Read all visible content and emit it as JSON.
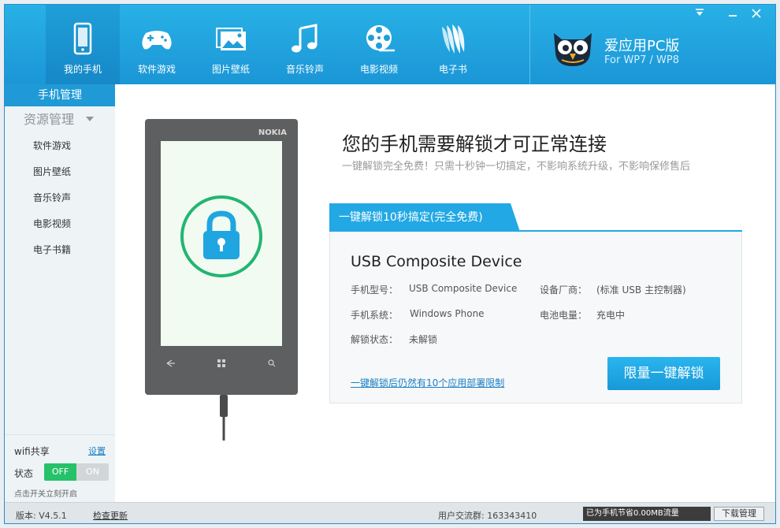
{
  "nav": {
    "items": [
      {
        "label": "我的手机",
        "icon": "phone-icon"
      },
      {
        "label": "软件游戏",
        "icon": "gamepad-icon"
      },
      {
        "label": "图片壁纸",
        "icon": "picture-icon"
      },
      {
        "label": "音乐铃声",
        "icon": "music-note-icon"
      },
      {
        "label": "电影视频",
        "icon": "film-reel-icon"
      },
      {
        "label": "电子书",
        "icon": "ebook-icon"
      }
    ]
  },
  "brand": {
    "name": "爱应用PC版",
    "subtitle": "For WP7 / WP8"
  },
  "sidebar": {
    "header": "手机管理",
    "group": "资源管理",
    "items": [
      "软件游戏",
      "图片壁纸",
      "音乐铃声",
      "电影视频",
      "电子书籍"
    ],
    "wifi": {
      "title": "wifi共享",
      "setup": "设置",
      "state_label": "状态",
      "off_label": "OFF",
      "on_label": "ON",
      "hint": "点击开关立刻开启"
    }
  },
  "main": {
    "phone_brand": "NOKIA",
    "headline": "您的手机需要解锁才可正常连接",
    "subline": "一键解锁完全免费！只需十秒钟一切搞定，不影响系统升级，不影响保修售后",
    "tab": "一键解锁10秒搞定(完全免费)",
    "device": {
      "name": "USB Composite Device",
      "model_label": "手机型号：",
      "model": "USB Composite Device",
      "vendor_label": "设备厂商：",
      "vendor": "(标准 USB 主控制器)",
      "os_label": "手机系统：",
      "os": "Windows Phone",
      "battery_label": "电池电量：",
      "battery": "充电中",
      "lock_label": "解锁状态：",
      "lock": "未解锁"
    },
    "link": "一键解锁后仍然有10个应用部署限制",
    "button": "限量一键解锁"
  },
  "status": {
    "version": "版本: V4.5.1",
    "check_update": "检查更新",
    "group": "用户交流群: 163343410",
    "flow": "已为手机节省0.00MB流量",
    "download_mgr": "下载管理"
  }
}
